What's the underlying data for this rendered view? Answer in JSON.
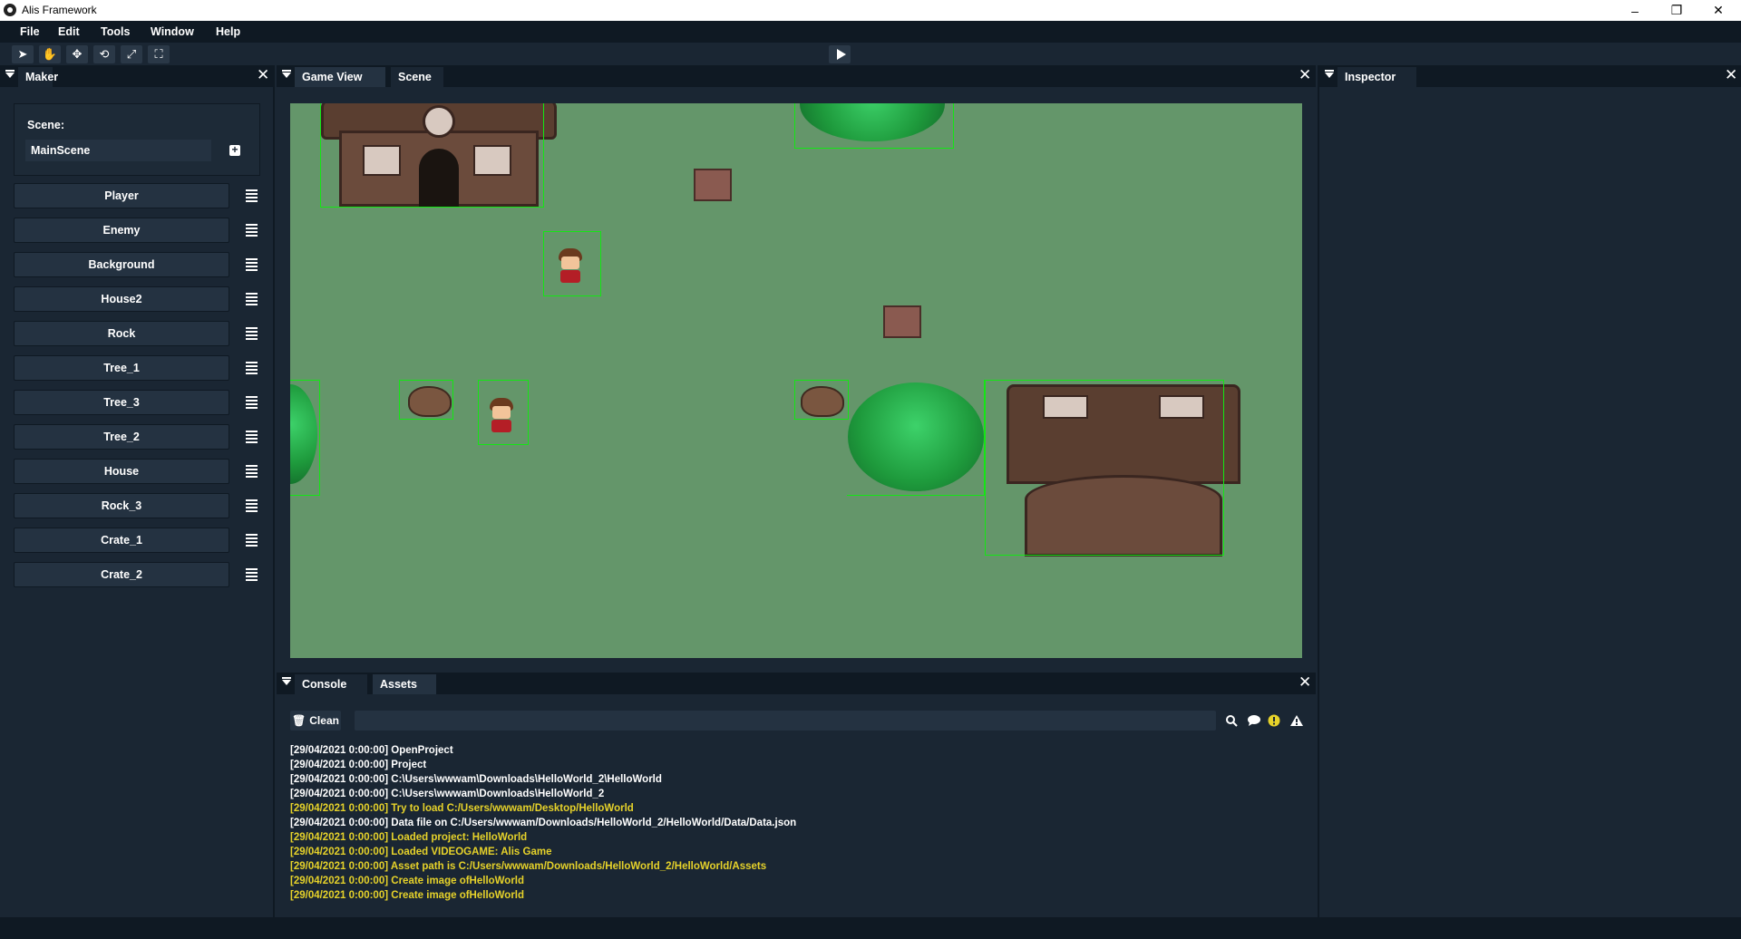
{
  "window": {
    "title": "Alis Framework",
    "controls": [
      "–",
      "❐",
      "✕"
    ]
  },
  "menu": [
    "File",
    "Edit",
    "Tools",
    "Window",
    "Help"
  ],
  "toolbar": {
    "tools": [
      {
        "name": "select-tool-icon",
        "glyph": "➤"
      },
      {
        "name": "hand-tool-icon",
        "glyph": "✋"
      },
      {
        "name": "move-tool-icon",
        "glyph": "✥"
      },
      {
        "name": "rotate-tool-icon",
        "glyph": "⟲"
      },
      {
        "name": "scale-tool-icon",
        "glyph": "⤢"
      },
      {
        "name": "rect-tool-icon",
        "glyph": "⛶"
      }
    ]
  },
  "maker": {
    "tab": "Maker",
    "scene_label": "Scene:",
    "scene_name": "MainScene",
    "entities": [
      "Player",
      "Enemy",
      "Background",
      "House2",
      "Rock",
      "Tree_1",
      "Tree_3",
      "Tree_2",
      "House",
      "Rock_3",
      "Crate_1",
      "Crate_2"
    ]
  },
  "center": {
    "tabs": [
      "Game View",
      "Scene"
    ],
    "active_tab": "Scene"
  },
  "inspector": {
    "tab": "Inspector"
  },
  "console": {
    "tabs": [
      "Console",
      "Assets"
    ],
    "clean_label": "Clean",
    "logs": [
      {
        "time": "[29/04/2021 0:00:00]",
        "msg": "OpenProject",
        "level": "info"
      },
      {
        "time": "[29/04/2021 0:00:00]",
        "msg": "Project",
        "level": "info"
      },
      {
        "time": "[29/04/2021 0:00:00]",
        "msg": "C:\\Users\\wwwam\\Downloads\\HelloWorld_2\\HelloWorld",
        "level": "info"
      },
      {
        "time": "[29/04/2021 0:00:00]",
        "msg": "C:\\Users\\wwwam\\Downloads\\HelloWorld_2",
        "level": "info"
      },
      {
        "time": "[29/04/2021 0:00:00]",
        "msg": "Try to load C:/Users/wwwam/Desktop/HelloWorld",
        "level": "warn"
      },
      {
        "time": "[29/04/2021 0:00:00]",
        "msg": "Data file on C:/Users/wwwam/Downloads/HelloWorld_2/HelloWorld/Data/Data.json",
        "level": "info"
      },
      {
        "time": "[29/04/2021 0:00:00]",
        "msg": "Loaded project: HelloWorld",
        "level": "warn"
      },
      {
        "time": "[29/04/2021 0:00:00]",
        "msg": "Loaded VIDEOGAME: Alis Game",
        "level": "warn"
      },
      {
        "time": "[29/04/2021 0:00:00]",
        "msg": "Asset path is C:/Users/wwwam/Downloads/HelloWorld_2/HelloWorld/Assets",
        "level": "warn"
      },
      {
        "time": "[29/04/2021 0:00:00]",
        "msg": "Create image ofHelloWorld",
        "level": "warn"
      },
      {
        "time": "[29/04/2021 0:00:00]",
        "msg": "Create image ofHelloWorld",
        "level": "warn"
      }
    ]
  },
  "colors": {
    "panel": "#1a2633",
    "header": "#0f1923",
    "scene_bg": "#64966a",
    "bounds": "#14e614",
    "warn": "#e6d22a"
  }
}
